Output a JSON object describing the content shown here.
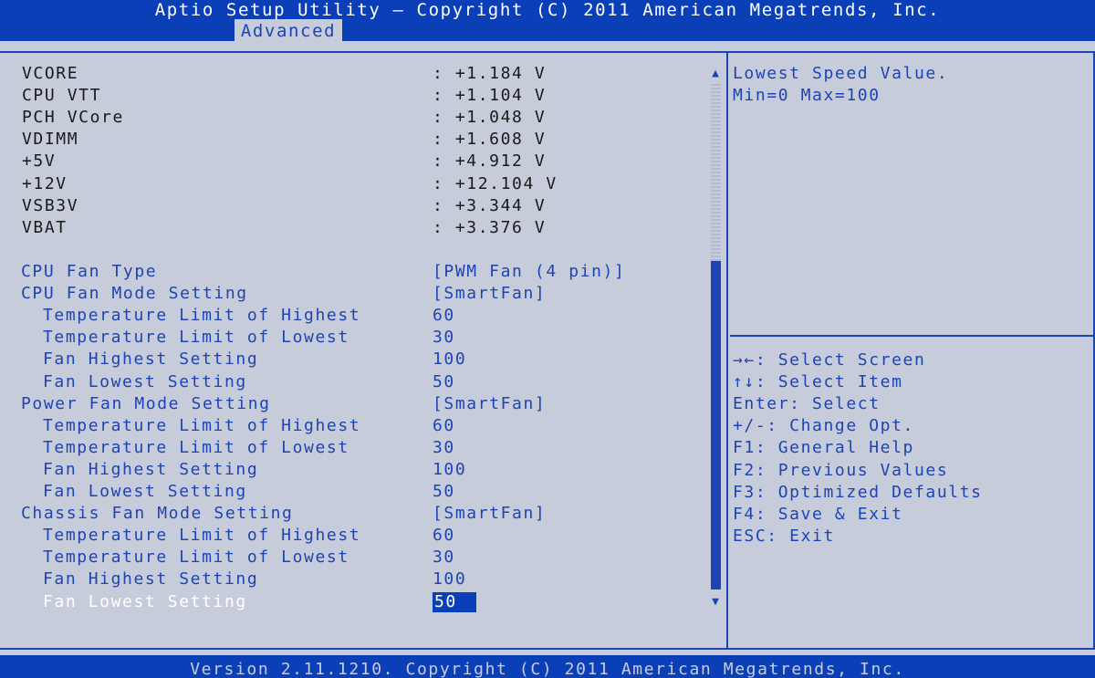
{
  "header": {
    "title": "Aptio Setup Utility – Copyright (C) 2011 American Megatrends, Inc.",
    "tabs": [
      {
        "label": "Advanced"
      }
    ]
  },
  "voltages": [
    {
      "label": "VCORE",
      "value": ": +1.184 V"
    },
    {
      "label": "CPU VTT",
      "value": ": +1.104 V"
    },
    {
      "label": "PCH VCore",
      "value": ": +1.048 V"
    },
    {
      "label": "VDIMM",
      "value": ": +1.608 V"
    },
    {
      "label": "+5V",
      "value": ": +4.912 V"
    },
    {
      "label": "+12V",
      "value": ": +12.104 V"
    },
    {
      "label": "VSB3V",
      "value": ": +3.344 V"
    },
    {
      "label": "VBAT",
      "value": ": +3.376 V"
    }
  ],
  "settings": [
    {
      "label": "CPU Fan Type",
      "value": "[PWM Fan (4 pin)]",
      "indent": false
    },
    {
      "label": "CPU Fan Mode Setting",
      "value": "[SmartFan]",
      "indent": false
    },
    {
      "label": "Temperature Limit of Highest",
      "value": "60",
      "indent": true
    },
    {
      "label": "Temperature Limit of Lowest",
      "value": "30",
      "indent": true
    },
    {
      "label": "Fan Highest Setting",
      "value": "100",
      "indent": true
    },
    {
      "label": "Fan Lowest Setting",
      "value": "50",
      "indent": true
    },
    {
      "label": "Power Fan Mode Setting",
      "value": "[SmartFan]",
      "indent": false
    },
    {
      "label": "Temperature Limit of Highest",
      "value": "60",
      "indent": true
    },
    {
      "label": "Temperature Limit of Lowest",
      "value": "30",
      "indent": true
    },
    {
      "label": "Fan Highest Setting",
      "value": "100",
      "indent": true
    },
    {
      "label": "Fan Lowest Setting",
      "value": "50",
      "indent": true
    },
    {
      "label": "Chassis Fan Mode Setting",
      "value": "[SmartFan]",
      "indent": false
    },
    {
      "label": "Temperature Limit of Highest",
      "value": "60",
      "indent": true
    },
    {
      "label": "Temperature Limit of Lowest",
      "value": "30",
      "indent": true
    },
    {
      "label": "Fan Highest Setting",
      "value": "100",
      "indent": true
    },
    {
      "label": "Fan Lowest Setting",
      "value": "50",
      "indent": true,
      "selected": true
    }
  ],
  "help": {
    "lines": [
      "Lowest Speed Value.",
      "Min=0 Max=100"
    ],
    "keys": [
      "→←: Select Screen",
      "↑↓: Select Item",
      "Enter: Select",
      "+/-: Change Opt.",
      "F1: General Help",
      "F2: Previous Values",
      "F3: Optimized Defaults",
      "F4: Save & Exit",
      "ESC: Exit"
    ]
  },
  "scrollbar": {
    "up_glyph": "▲",
    "down_glyph": "▼",
    "thumb_start_fraction": 0.35,
    "thumb_end_fraction": 1.0
  },
  "footer": {
    "text": "Version 2.11.1210. Copyright (C) 2011 American Megatrends, Inc."
  },
  "colors": {
    "header_bg": "#0a3fb8",
    "body_bg": "#c7ccdb",
    "option_text": "#1e44b4",
    "static_text": "#1a1a1a",
    "selected_text": "#ffffff"
  }
}
